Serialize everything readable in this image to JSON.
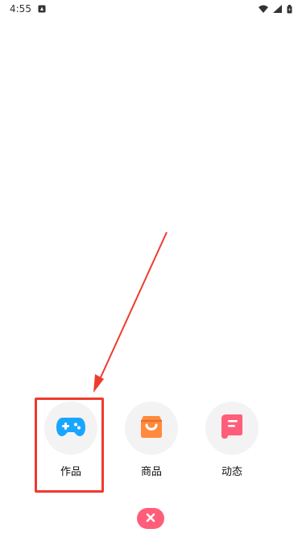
{
  "status_bar": {
    "time": "4:55",
    "icons": [
      "notification-icon",
      "wifi-icon",
      "signal-icon",
      "battery-icon"
    ]
  },
  "publish_menu": {
    "items": [
      {
        "label": "作品",
        "icon": "gamepad-icon",
        "color": "#1aa6ff"
      },
      {
        "label": "商品",
        "icon": "shopping-bag-icon",
        "color": "#ff8a3d"
      },
      {
        "label": "动态",
        "icon": "scroll-icon",
        "color": "#ff5d79"
      }
    ],
    "close_icon": "close-icon",
    "close_color": "#ff5d79"
  },
  "annotation": {
    "highlight_color": "#ef3a2e",
    "arrow_color": "#ef3a2e"
  }
}
